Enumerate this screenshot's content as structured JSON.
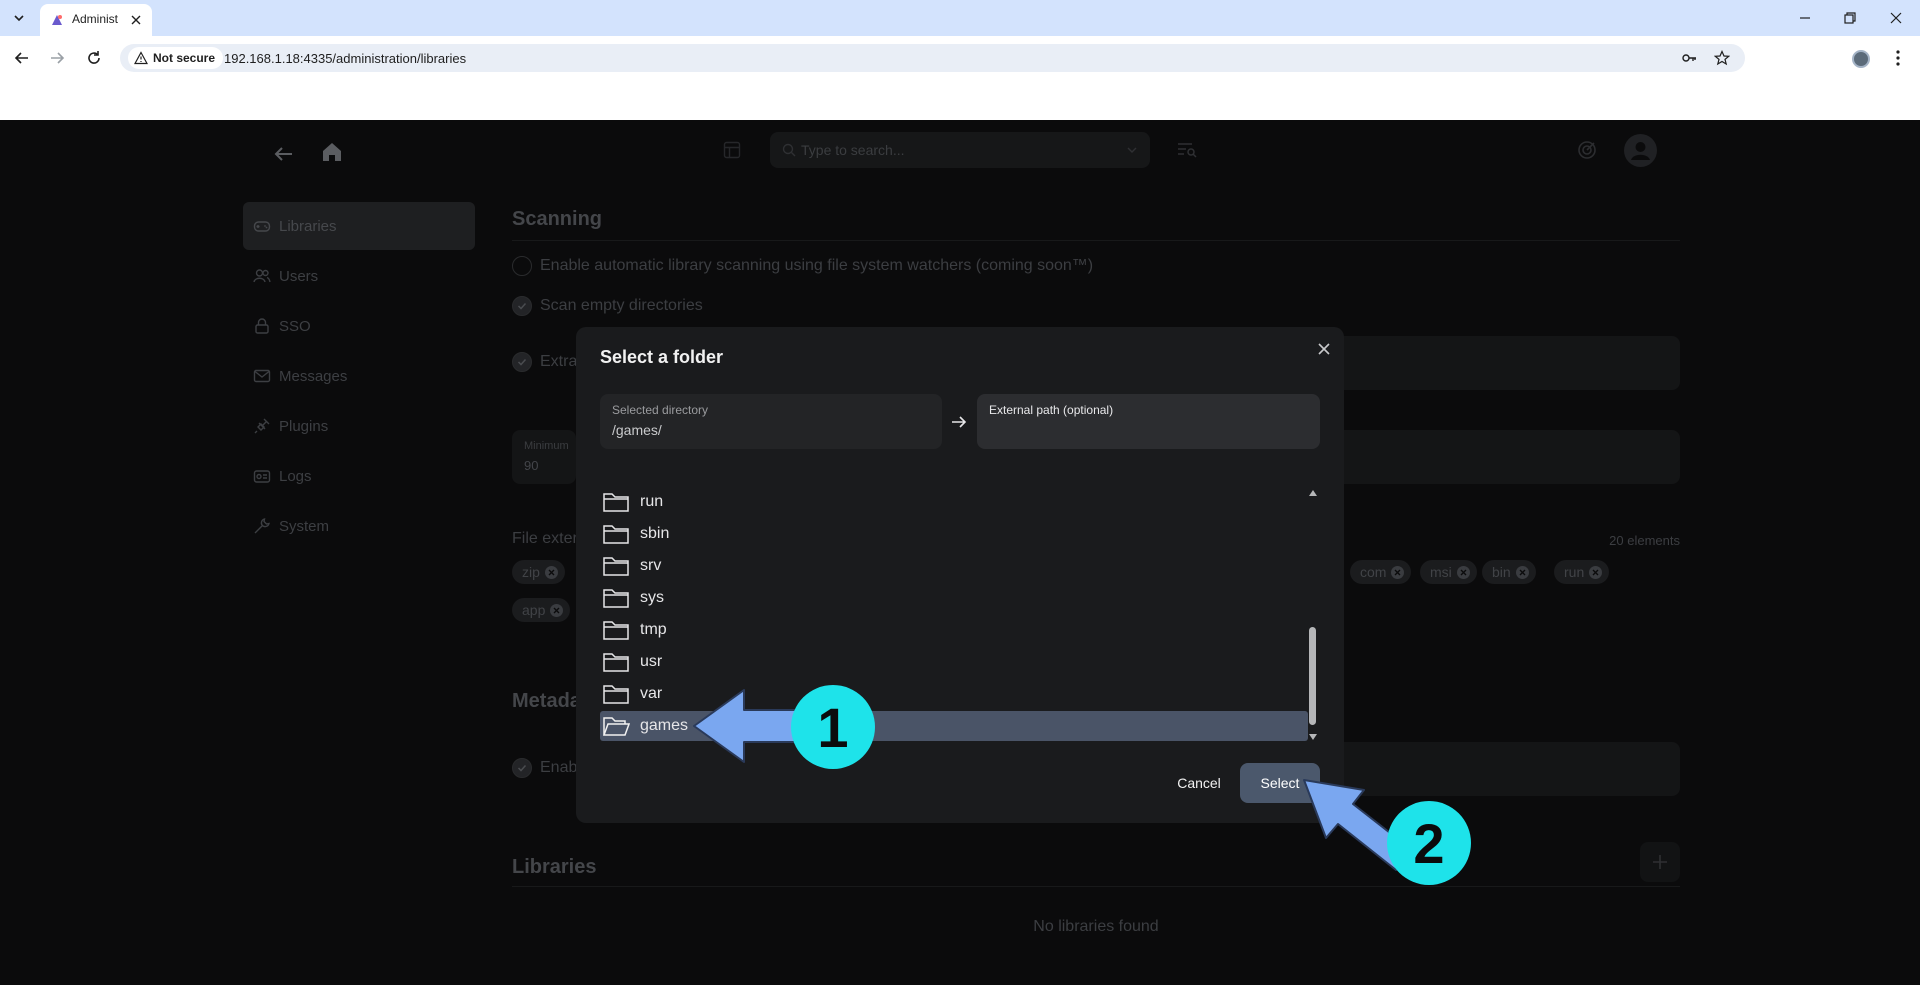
{
  "browser": {
    "tab_title": "Administ",
    "security_label": "Not secure",
    "url": "192.168.1.18:4335/administration/libraries"
  },
  "header": {
    "search_placeholder": "Type to search..."
  },
  "sidebar": {
    "items": [
      {
        "label": "Libraries",
        "icon": "gamepad-icon",
        "active": true
      },
      {
        "label": "Users",
        "icon": "users-icon"
      },
      {
        "label": "SSO",
        "icon": "lock-icon"
      },
      {
        "label": "Messages",
        "icon": "mail-icon"
      },
      {
        "label": "Plugins",
        "icon": "plug-icon"
      },
      {
        "label": "Logs",
        "icon": "logs-icon"
      },
      {
        "label": "System",
        "icon": "wrench-icon"
      }
    ]
  },
  "main": {
    "scanning_title": "Scanning",
    "watchers_label": "Enable automatic library scanning using file system watchers (coming soon™)",
    "scan_empty_label": "Scan empty directories",
    "extra_label": "Extra",
    "minimum_label": "Minimum",
    "minimum_value": "90",
    "file_ext_label": "File exter",
    "elements_count": "20 elements",
    "chips_row1_left": [
      "zip"
    ],
    "chips_row1_right": [
      "com",
      "msi",
      "bin",
      "run"
    ],
    "chips_row2": [
      "app"
    ],
    "metadata_title": "Metada",
    "enable_label": "Enab",
    "libraries_title": "Libraries",
    "no_libraries": "No libraries found"
  },
  "modal": {
    "title": "Select a folder",
    "selected_dir_label": "Selected directory",
    "selected_dir_value": "/games/",
    "external_path_label": "External path (optional)",
    "folders": [
      "run",
      "sbin",
      "srv",
      "sys",
      "tmp",
      "usr",
      "var",
      "games"
    ],
    "selected_folder": "games",
    "cancel_label": "Cancel",
    "select_label": "Select"
  },
  "annotations": {
    "step1": "1",
    "step2": "2",
    "color": "#1ee3ea",
    "arrow_color": "#7aa7f0"
  }
}
